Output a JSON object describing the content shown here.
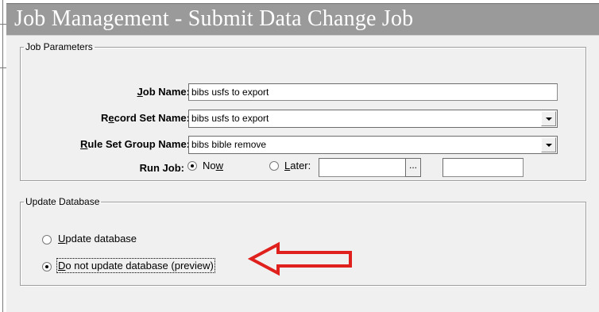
{
  "window": {
    "title": "Job Management - Submit Data Change Job"
  },
  "job_parameters": {
    "legend": "Job Parameters",
    "job_name": {
      "label_pre": "",
      "label_key": "J",
      "label_post": "ob Name:",
      "value": "bibs usfs to export"
    },
    "record_set": {
      "label_pre": "R",
      "label_key": "e",
      "label_post": "cord Set Name:",
      "value": "bibs usfs to export"
    },
    "rule_set": {
      "label_pre": "",
      "label_key": "R",
      "label_post": "ule Set Group Name:",
      "value": "bibs bible remove"
    },
    "run_job": {
      "label": "Run Job:",
      "now": {
        "pre": "No",
        "key": "w",
        "post": "",
        "selected": true
      },
      "later": {
        "pre": "",
        "key": "L",
        "post": "ater:",
        "selected": false
      },
      "date_value": "",
      "browse_label": "...",
      "time_value": ""
    }
  },
  "update_database": {
    "legend": "Update Database",
    "update": {
      "pre": "",
      "key": "U",
      "post": "pdate database",
      "selected": false
    },
    "preview": {
      "pre": "",
      "key": "D",
      "post": "o not update database (preview)",
      "selected": true
    }
  },
  "colors": {
    "titlebar": "#9a9a9a",
    "arrow": "#e0201c",
    "dialog_bg": "#f0f0f0"
  }
}
